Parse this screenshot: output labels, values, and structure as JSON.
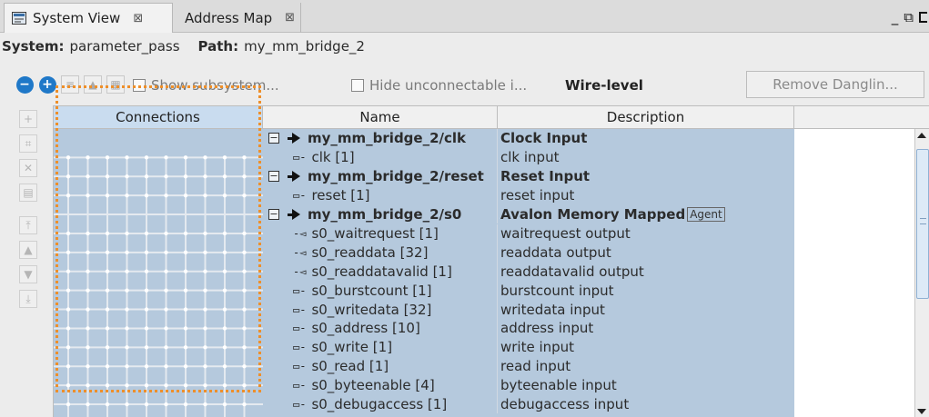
{
  "tabs": [
    {
      "label": "System View",
      "close": "⊠",
      "icon": "system-view-icon"
    },
    {
      "label": "Address Map",
      "close": "⊠"
    }
  ],
  "window_controls": {
    "minimize": "_",
    "restore": "⧉"
  },
  "system": {
    "system_label": "System:",
    "system_value": "parameter_pass",
    "path_label": "Path:",
    "path_value": "my_mm_bridge_2"
  },
  "toolbar": {
    "show_subsystem": "Show subsystem...",
    "hide_unconnectable": "Hide unconnectable i...",
    "wire_level": "Wire-level",
    "remove_dangling": "Remove Danglin..."
  },
  "table": {
    "headers": {
      "connections": "Connections",
      "name": "Name",
      "description": "Description",
      "extra": ""
    },
    "rows": [
      {
        "type": "iface",
        "name": "my_mm_bridge_2/clk",
        "desc": "Clock Input"
      },
      {
        "type": "port",
        "dir": "in",
        "name": "clk [1]",
        "desc": "clk input"
      },
      {
        "type": "iface",
        "name": "my_mm_bridge_2/reset",
        "desc": "Reset Input"
      },
      {
        "type": "port",
        "dir": "in",
        "name": "reset [1]",
        "desc": "reset input"
      },
      {
        "type": "iface",
        "name": "my_mm_bridge_2/s0",
        "desc": "Avalon Memory Mapped",
        "tag": "Agent"
      },
      {
        "type": "port",
        "dir": "out",
        "name": "s0_waitrequest [1]",
        "desc": "waitrequest output"
      },
      {
        "type": "port",
        "dir": "out",
        "name": "s0_readdata [32]",
        "desc": "readdata output"
      },
      {
        "type": "port",
        "dir": "out",
        "name": "s0_readdatavalid [1]",
        "desc": "readdatavalid output"
      },
      {
        "type": "port",
        "dir": "in",
        "name": "s0_burstcount [1]",
        "desc": "burstcount input"
      },
      {
        "type": "port",
        "dir": "in",
        "name": "s0_writedata [32]",
        "desc": "writedata input"
      },
      {
        "type": "port",
        "dir": "in",
        "name": "s0_address [10]",
        "desc": "address input"
      },
      {
        "type": "port",
        "dir": "in",
        "name": "s0_write [1]",
        "desc": "write input"
      },
      {
        "type": "port",
        "dir": "in",
        "name": "s0_read [1]",
        "desc": "read input"
      },
      {
        "type": "port",
        "dir": "in",
        "name": "s0_byteenable [4]",
        "desc": "byteenable input"
      },
      {
        "type": "port",
        "dir": "in",
        "name": "s0_debugaccess [1]",
        "desc": "debugaccess input"
      }
    ]
  },
  "colors": {
    "selection": "#b5c9dd",
    "focus": "#ee8f2a",
    "zoom": "#1f78c8"
  }
}
